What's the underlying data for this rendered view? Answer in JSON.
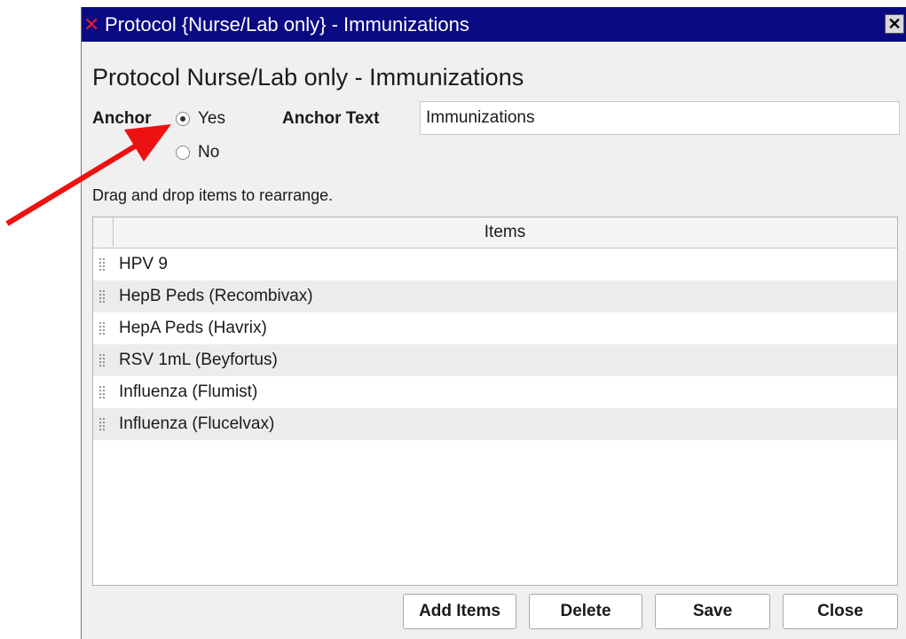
{
  "window": {
    "title": "Protocol {Nurse/Lab only} - Immunizations",
    "app_icon": "✕",
    "close_glyph": "✕"
  },
  "form": {
    "heading": "Protocol Nurse/Lab only - Immunizations",
    "anchor_label": "Anchor",
    "anchor_options": [
      {
        "label": "Yes",
        "checked": true
      },
      {
        "label": "No",
        "checked": false
      }
    ],
    "anchor_text_label": "Anchor Text",
    "anchor_text_value": "Immunizations",
    "hint": "Drag and drop items to rearrange."
  },
  "grid": {
    "column_header": "Items",
    "rows": [
      "HPV 9",
      "HepB Peds (Recombivax)",
      "HepA Peds (Havrix)",
      "RSV 1mL (Beyfortus)",
      "Influenza (Flumist)",
      "Influenza (Flucelvax)"
    ]
  },
  "buttons": {
    "add_items": "Add Items",
    "delete": "Delete",
    "save": "Save",
    "close": "Close"
  },
  "colors": {
    "titlebar": "#0a0a82",
    "annotation_arrow": "#ee1111"
  }
}
